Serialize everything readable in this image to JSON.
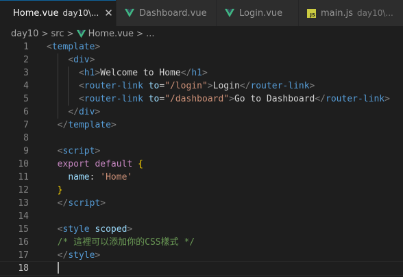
{
  "tabs": [
    {
      "name": "Home.vue",
      "desc": "day10\\...",
      "icon": "vue-icon",
      "active": true,
      "close": "✕"
    },
    {
      "name": "Dashboard.vue",
      "desc": "",
      "icon": "vue-icon",
      "active": false
    },
    {
      "name": "Login.vue",
      "desc": "",
      "icon": "vue-icon",
      "active": false
    },
    {
      "name": "main.js",
      "desc": "day10\\...",
      "icon": "js-icon",
      "active": false,
      "icon_text": "JS"
    }
  ],
  "breadcrumb": {
    "items": [
      "day10",
      "src",
      "Home.vue",
      "..."
    ],
    "separator": ">"
  },
  "editor": {
    "current_line": 18,
    "lines": [
      {
        "n": "1",
        "tokens": [
          [
            "t-bracket",
            "<"
          ],
          [
            "t-tag",
            "template"
          ],
          [
            "t-bracket",
            ">"
          ]
        ]
      },
      {
        "n": "2",
        "tokens": [
          [
            "t-text",
            "    "
          ],
          [
            "t-bracket",
            "<"
          ],
          [
            "t-tag",
            "div"
          ],
          [
            "t-bracket",
            ">"
          ]
        ]
      },
      {
        "n": "3",
        "tokens": [
          [
            "t-text",
            "      "
          ],
          [
            "t-bracket",
            "<"
          ],
          [
            "t-tag",
            "h1"
          ],
          [
            "t-bracket",
            ">"
          ],
          [
            "t-text",
            "Welcome to Home"
          ],
          [
            "t-bracket",
            "</"
          ],
          [
            "t-tag",
            "h1"
          ],
          [
            "t-bracket",
            ">"
          ]
        ]
      },
      {
        "n": "4",
        "tokens": [
          [
            "t-text",
            "      "
          ],
          [
            "t-bracket",
            "<"
          ],
          [
            "t-tag",
            "router-link"
          ],
          [
            "t-text",
            " "
          ],
          [
            "t-attr",
            "to"
          ],
          [
            "t-eq",
            "="
          ],
          [
            "t-str",
            "\"/login\""
          ],
          [
            "t-bracket",
            ">"
          ],
          [
            "t-text",
            "Login"
          ],
          [
            "t-bracket",
            "</"
          ],
          [
            "t-tag",
            "router-link"
          ],
          [
            "t-bracket",
            ">"
          ]
        ]
      },
      {
        "n": "5",
        "tokens": [
          [
            "t-text",
            "      "
          ],
          [
            "t-bracket",
            "<"
          ],
          [
            "t-tag",
            "router-link"
          ],
          [
            "t-text",
            " "
          ],
          [
            "t-attr",
            "to"
          ],
          [
            "t-eq",
            "="
          ],
          [
            "t-str",
            "\"/dashboard\""
          ],
          [
            "t-bracket",
            ">"
          ],
          [
            "t-text",
            "Go to Dashboard"
          ],
          [
            "t-bracket",
            "</"
          ],
          [
            "t-tag",
            "router-link"
          ],
          [
            "t-bracket",
            ">"
          ]
        ]
      },
      {
        "n": "6",
        "tokens": [
          [
            "t-text",
            "    "
          ],
          [
            "t-bracket",
            "</"
          ],
          [
            "t-tag",
            "div"
          ],
          [
            "t-bracket",
            ">"
          ]
        ]
      },
      {
        "n": "7",
        "tokens": [
          [
            "t-text",
            "  "
          ],
          [
            "t-bracket",
            "</"
          ],
          [
            "t-tag",
            "template"
          ],
          [
            "t-bracket",
            ">"
          ]
        ]
      },
      {
        "n": "8",
        "tokens": []
      },
      {
        "n": "9",
        "tokens": [
          [
            "t-text",
            "  "
          ],
          [
            "t-bracket",
            "<"
          ],
          [
            "t-tag",
            "script"
          ],
          [
            "t-bracket",
            ">"
          ]
        ]
      },
      {
        "n": "10",
        "tokens": [
          [
            "t-text",
            "  "
          ],
          [
            "t-kw",
            "export"
          ],
          [
            "t-text",
            " "
          ],
          [
            "t-kw",
            "default"
          ],
          [
            "t-text",
            " "
          ],
          [
            "t-brace",
            "{"
          ]
        ]
      },
      {
        "n": "11",
        "tokens": [
          [
            "t-text",
            "    "
          ],
          [
            "t-prop",
            "name"
          ],
          [
            "t-text",
            ": "
          ],
          [
            "t-str",
            "'Home'"
          ]
        ]
      },
      {
        "n": "12",
        "tokens": [
          [
            "t-text",
            "  "
          ],
          [
            "t-brace",
            "}"
          ]
        ]
      },
      {
        "n": "13",
        "tokens": [
          [
            "t-text",
            "  "
          ],
          [
            "t-bracket",
            "</"
          ],
          [
            "t-tag",
            "script"
          ],
          [
            "t-bracket",
            ">"
          ]
        ]
      },
      {
        "n": "14",
        "tokens": []
      },
      {
        "n": "15",
        "tokens": [
          [
            "t-text",
            "  "
          ],
          [
            "t-bracket",
            "<"
          ],
          [
            "t-tag",
            "style"
          ],
          [
            "t-text",
            " "
          ],
          [
            "t-attr",
            "scoped"
          ],
          [
            "t-bracket",
            ">"
          ]
        ]
      },
      {
        "n": "16",
        "tokens": [
          [
            "t-text",
            "  "
          ],
          [
            "t-comment",
            "/* 這裡可以添加你的CSS樣式 */"
          ]
        ]
      },
      {
        "n": "17",
        "tokens": [
          [
            "t-text",
            "  "
          ],
          [
            "t-bracket",
            "</"
          ],
          [
            "t-tag",
            "style"
          ],
          [
            "t-bracket",
            ">"
          ]
        ]
      },
      {
        "n": "18",
        "tokens": [
          [
            "t-text",
            "  "
          ]
        ]
      }
    ]
  },
  "colors": {
    "vue_green": "#41b883",
    "vue_dark": "#35495e",
    "js_yellow": "#cbcb41",
    "accent": "#0e639c"
  }
}
